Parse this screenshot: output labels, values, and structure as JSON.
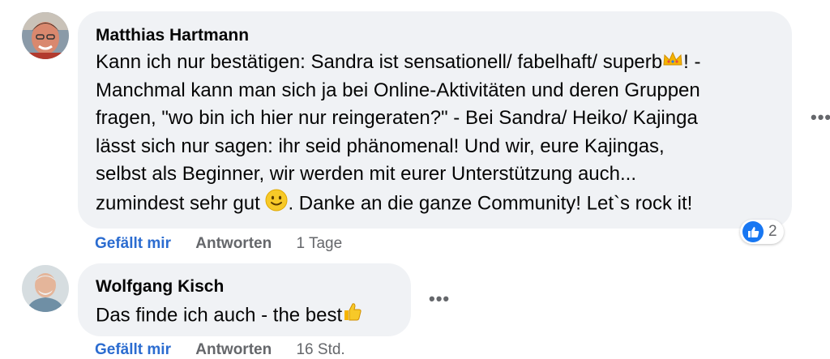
{
  "comments": [
    {
      "author": "Matthias Hartmann",
      "lines": [
        "Kann ich nur bestätigen: Sandra ist sensationell/ fabelhaft/ superb",
        "! -",
        "Manchmal kann man sich ja bei Online-Aktivitäten und deren Gruppen",
        "fragen, \"wo bin ich hier nur reingeraten?\" - Bei Sandra/ Heiko/ Kajinga",
        "lässt sich nur sagen: ihr seid phänomenal! Und wir, eure Kajingas,",
        "selbst als Beginner, wir werden mit eurer Unterstützung auch...",
        "zumindest sehr gut ",
        ". Danke an die ganze Community! Let`s rock it!"
      ],
      "like_label": "Gefällt mir",
      "reply_label": "Antworten",
      "time": "1 Tage",
      "reaction_count": "2",
      "more_icon": "more-options-icon"
    },
    {
      "author": "Wolfgang Kisch",
      "text": "Das finde ich auch - the best",
      "like_label": "Gefällt mir",
      "reply_label": "Antworten",
      "time": "16 Std.",
      "more_icon": "more-options-icon"
    }
  ],
  "colors": {
    "bubble": "#f0f2f5",
    "action_link": "#2b6cd0",
    "muted": "#65676b",
    "like_badge": "#1877f2"
  }
}
